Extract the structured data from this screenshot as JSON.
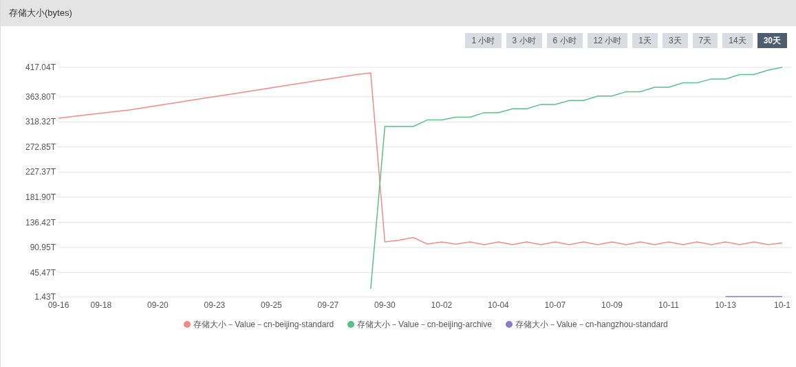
{
  "panel": {
    "title": "存储大小(bytes)"
  },
  "time_ranges": [
    {
      "label": "1 小时",
      "selected": false
    },
    {
      "label": "3 小时",
      "selected": false
    },
    {
      "label": "6 小时",
      "selected": false
    },
    {
      "label": "12 小时",
      "selected": false
    },
    {
      "label": "1天",
      "selected": false
    },
    {
      "label": "3天",
      "selected": false
    },
    {
      "label": "7天",
      "selected": false
    },
    {
      "label": "14天",
      "selected": false
    },
    {
      "label": "30天",
      "selected": true
    }
  ],
  "chart_data": {
    "type": "line",
    "categories": [
      "09-16",
      null,
      null,
      "09-18",
      null,
      null,
      null,
      "09-20",
      null,
      null,
      null,
      "09-23",
      null,
      null,
      null,
      "09-25",
      null,
      null,
      null,
      "09-27",
      null,
      null,
      null,
      "09-30",
      null,
      null,
      null,
      "10-02",
      null,
      null,
      null,
      "10-04",
      null,
      null,
      null,
      "10-07",
      null,
      null,
      null,
      "10-09",
      null,
      null,
      null,
      "10-11",
      null,
      null,
      null,
      "10-13",
      null,
      null,
      null,
      "10-1"
    ],
    "series": [
      {
        "name": "存储大小－Value－cn-beijing-standard",
        "color": "#f08a87",
        "values": [
          325,
          328,
          331,
          334,
          337,
          340,
          344,
          348,
          352,
          356,
          360,
          364,
          368,
          372,
          376,
          380,
          384,
          388,
          392,
          396,
          400,
          404,
          407,
          101,
          104,
          109,
          97,
          101,
          97,
          101,
          96,
          101,
          96,
          101,
          96,
          101,
          96,
          101,
          96,
          101,
          96,
          101,
          96,
          101,
          96,
          101,
          96,
          101,
          96,
          101,
          96,
          99
        ]
      },
      {
        "name": "存储大小－Value－cn-beijing-archive",
        "color": "#5bbf85",
        "values": [
          null,
          null,
          null,
          null,
          null,
          null,
          null,
          null,
          null,
          null,
          null,
          null,
          null,
          null,
          null,
          null,
          null,
          null,
          null,
          null,
          null,
          null,
          16,
          310,
          310,
          310,
          322,
          322,
          327,
          327,
          335,
          335,
          342,
          342,
          350,
          350,
          357,
          357,
          365,
          365,
          373,
          373,
          381,
          381,
          389,
          389,
          396,
          396,
          404,
          404,
          412,
          417
        ]
      },
      {
        "name": "存储大小－Value－cn-hangzhou-standard",
        "color": "#9079c4",
        "values": [
          null,
          null,
          null,
          null,
          null,
          null,
          null,
          null,
          null,
          null,
          null,
          null,
          null,
          null,
          null,
          null,
          null,
          null,
          null,
          null,
          null,
          null,
          null,
          null,
          null,
          null,
          null,
          null,
          null,
          null,
          null,
          null,
          null,
          null,
          null,
          null,
          null,
          null,
          null,
          null,
          null,
          null,
          null,
          null,
          null,
          null,
          null,
          2,
          2,
          2,
          2,
          2
        ]
      }
    ],
    "ylim": [
      1.43,
      417.04
    ],
    "grid": true,
    "legend": "bottom",
    "yticks": [
      {
        "value": 1.43,
        "label": "1.43T"
      },
      {
        "value": 45.47,
        "label": "45.47T"
      },
      {
        "value": 90.95,
        "label": "90.95T"
      },
      {
        "value": 136.42,
        "label": "136.42T"
      },
      {
        "value": 181.9,
        "label": "181.90T"
      },
      {
        "value": 227.37,
        "label": "227.37T"
      },
      {
        "value": 272.85,
        "label": "272.85T"
      },
      {
        "value": 318.32,
        "label": "318.32T"
      },
      {
        "value": 363.8,
        "label": "363.80T"
      },
      {
        "value": 417.04,
        "label": "417.04T"
      }
    ]
  }
}
